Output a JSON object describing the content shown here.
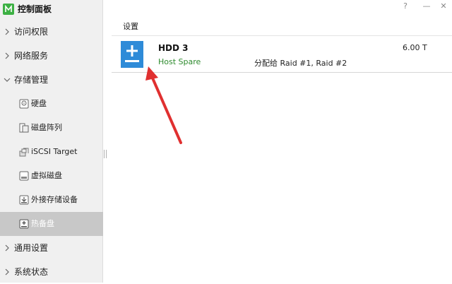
{
  "app": {
    "title": "控制面板"
  },
  "window": {
    "help": "?",
    "minimize": "—",
    "close": "✕"
  },
  "sidebar": {
    "items": [
      {
        "label": "访问权限"
      },
      {
        "label": "网络服务"
      },
      {
        "label": "存储管理"
      },
      {
        "label": "通用设置"
      },
      {
        "label": "系统状态"
      }
    ],
    "storage_sub": [
      {
        "label": "硬盘",
        "icon": "hdd-icon"
      },
      {
        "label": "磁盘阵列",
        "icon": "raid-icon"
      },
      {
        "label": "iSCSI Target",
        "icon": "iscsi-icon"
      },
      {
        "label": "虚拟磁盘",
        "icon": "virtual-disk-icon"
      },
      {
        "label": "外接存储设备",
        "icon": "external-storage-icon"
      },
      {
        "label": "热备盘",
        "icon": "hot-spare-icon",
        "active": true
      }
    ]
  },
  "main": {
    "section_title": "设置",
    "disk": {
      "name": "HDD 3",
      "status": "Host Spare",
      "assigned": "分配给 Raid #1, Raid #2",
      "size": "6.00 T",
      "icon": "hot-spare-disk-icon"
    }
  },
  "colors": {
    "accent": "#2e8bd8",
    "status_green": "#2e8b2e",
    "logo_green": "#3cb043",
    "annotation_red": "#e03030"
  }
}
